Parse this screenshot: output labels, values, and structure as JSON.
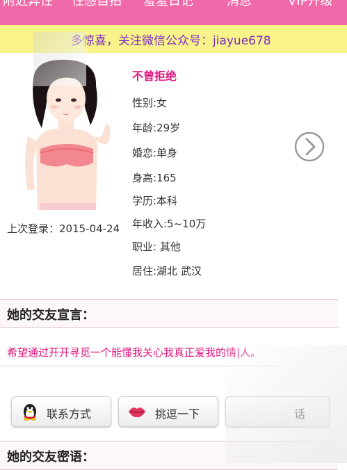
{
  "nav": {
    "items": [
      "附近异性",
      "性感自拍",
      "羞羞日记",
      "消息",
      "VIP升级"
    ]
  },
  "banner": {
    "text": "多惊喜，关注微信公众号：jiayue678"
  },
  "profile": {
    "name": "不曾拒绝",
    "gender": "性别:女",
    "age": "年龄:29岁",
    "marital": "婚恋:单身",
    "height": "身高:165",
    "education": "学历:本科",
    "income": "年收入:5~10万",
    "job": "职业: 其他",
    "residence": "居住:湖北 武汉",
    "last_login": "上次登录：2015-04-24"
  },
  "declaration": {
    "title": "她的交友宣言：",
    "text": "希望通过开开寻觅一个能懂我关心我真正爱我的情|人。"
  },
  "buttons": {
    "contact": "联系方式",
    "tease": "挑逗一下",
    "third": "话"
  },
  "secret": {
    "title": "她的交友密语："
  },
  "colors": {
    "nav_bg": "#f06aa9",
    "banner_bg": "#f8f489",
    "banner_text": "#7b2bc2",
    "accent_pink": "#e0177f"
  },
  "icons": {
    "next": "chevron-right-circle-icon",
    "contact": "qq-penguin-icon",
    "tease": "lips-icon"
  }
}
